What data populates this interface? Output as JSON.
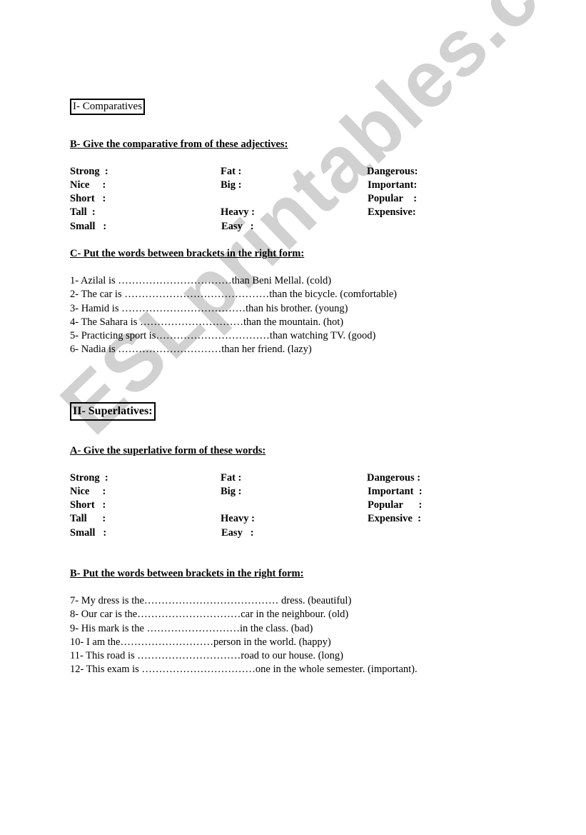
{
  "watermark": "ESLprintables.com",
  "section1": {
    "title": "I- Comparatives",
    "partB": {
      "heading": "B- Give the comparative from of these adjectives:",
      "col1": [
        "Strong  :",
        "Nice     :",
        "Short   :",
        "Tall  :",
        "Small   :"
      ],
      "col2": [
        "Fat :",
        "Big :",
        "",
        "Heavy :",
        "Easy   :"
      ],
      "col3": [
        "Dangerous:",
        "Important:",
        "Popular    :",
        "Expensive:",
        ""
      ]
    },
    "partC": {
      "heading": "C- Put the words between brackets in the right form:",
      "items": [
        "1- Azilal is ……………………………than Beni Mellal. (cold)",
        "2- The car is ……………………………………than the bicycle. (comfortable)",
        "3- Hamid is ………………………………than his brother. (young)",
        "4- The Sahara is …………………………than the mountain. (hot)",
        "5- Practicing sport is……………………………than watching TV. (good)",
        "6- Nadia is …………………………than her friend. (lazy)"
      ]
    }
  },
  "section2": {
    "title": "II- Superlatives:",
    "partA": {
      "heading": "A- Give the superlative form of these words:",
      "col1": [
        "Strong  :",
        "Nice     :",
        "Short   :",
        "Tall      :",
        "Small   :"
      ],
      "col2": [
        "Fat :",
        "Big :",
        "",
        "Heavy :",
        "Easy   :"
      ],
      "col3": [
        "Dangerous :",
        "Important  :",
        "Popular      :",
        "Expensive  :",
        ""
      ]
    },
    "partB": {
      "heading": "B- Put the words between brackets in the right form:",
      "items": [
        "7- My dress is the………………………………… dress. (beautiful)",
        "8- Our car is the…………………………car in the neighbour. (old)",
        "9- His mark is the ………………………in the class. (bad)",
        "10- I am the………………………person in the world. (happy)",
        "11- This road is …………………………road to our house. (long)",
        "12- This exam is ……………………………one in the whole semester. (important)."
      ]
    }
  }
}
